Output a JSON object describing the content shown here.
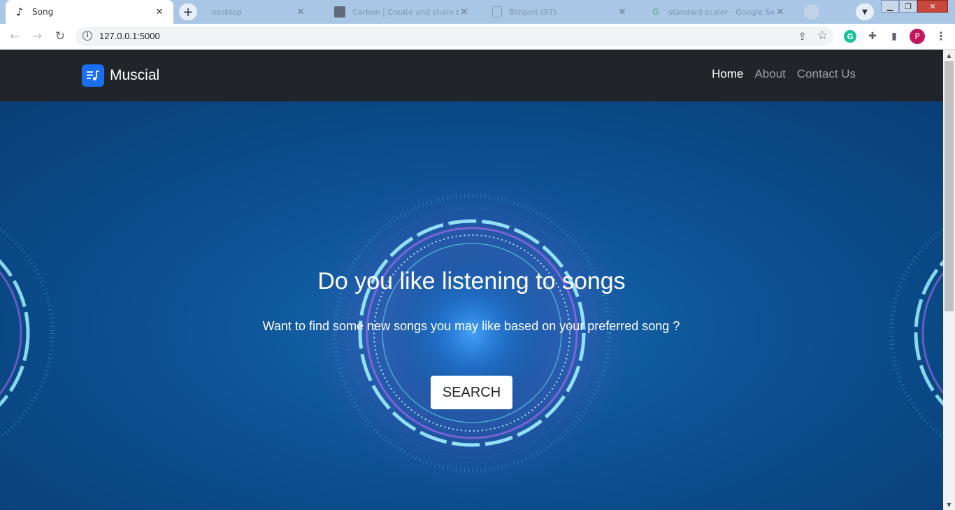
{
  "browser": {
    "tabs": [
      {
        "title": "Song",
        "active": true,
        "icon": "music-note-icon"
      },
      {
        "title": "desktop",
        "active": false,
        "icon": "blank-icon"
      },
      {
        "title": "Carbon | Create and share be...",
        "active": false,
        "icon": "carbon-icon"
      },
      {
        "title": "Blinjent (97)",
        "active": false,
        "icon": "page-icon"
      },
      {
        "title": "standard scaler - Google Sea...",
        "active": false,
        "icon": "google-icon"
      }
    ],
    "new_tab_symbol": "+",
    "address": "127.0.0.1:5000",
    "profile_initial": "P"
  },
  "site": {
    "brand": "Muscial",
    "nav": [
      {
        "label": "Home",
        "active": true
      },
      {
        "label": "About",
        "active": false
      },
      {
        "label": "Contact Us",
        "active": false
      }
    ],
    "hero": {
      "title": "Do you like listening to songs",
      "subtitle": "Want to find some new songs you may like based on your preferred song ?",
      "button_label": "SEARCH"
    }
  },
  "colors": {
    "navbar_bg": "#212429",
    "brand_accent": "#1b6ef3",
    "hero_bg": "#0e5699",
    "ring_cyan": "#8fe6f5",
    "ring_purple": "#b04cf0"
  }
}
